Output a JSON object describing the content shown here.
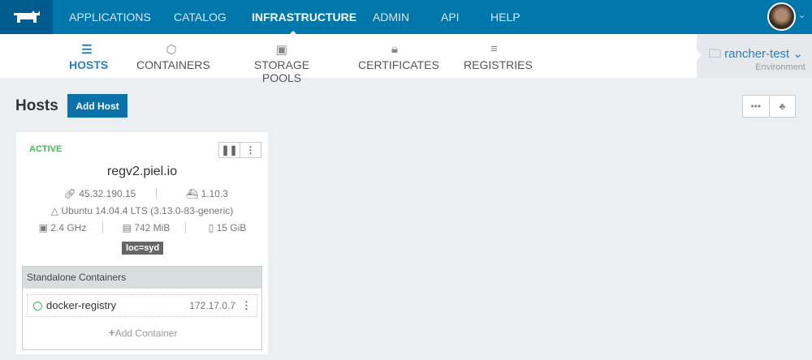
{
  "top_nav": {
    "items": [
      "APPLICATIONS",
      "CATALOG",
      "INFRASTRUCTURE",
      "ADMIN",
      "API",
      "HELP"
    ],
    "active": "INFRASTRUCTURE"
  },
  "sub_nav": {
    "items": [
      "HOSTS",
      "CONTAINERS",
      "STORAGE POOLS",
      "CERTIFICATES",
      "REGISTRIES"
    ],
    "active": "HOSTS"
  },
  "environment": {
    "name": "rancher-test",
    "label": "Environment"
  },
  "page": {
    "title": "Hosts",
    "add_button": "Add Host",
    "more": "•••"
  },
  "host": {
    "state": "ACTIVE",
    "name": "regv2.piel.io",
    "ip": "45.32.190.15",
    "docker_version": "1.10.3",
    "os": "Ubuntu 14.04.4 LTS (3.13.0-83-generic)",
    "cpu": "2.4 GHz",
    "memory": "742 MiB",
    "storage": "15 GiB",
    "label": "loc=syd",
    "containers_header": "Standalone Containers",
    "containers": [
      {
        "name": "docker-registry",
        "ip": "172.17.0.7"
      }
    ],
    "add_container": "Add Container"
  },
  "colors": {
    "nav": "#0077aa",
    "logo_bg": "#005c8f",
    "accent": "#2c7fb8",
    "active_state": "#4bb35a"
  }
}
